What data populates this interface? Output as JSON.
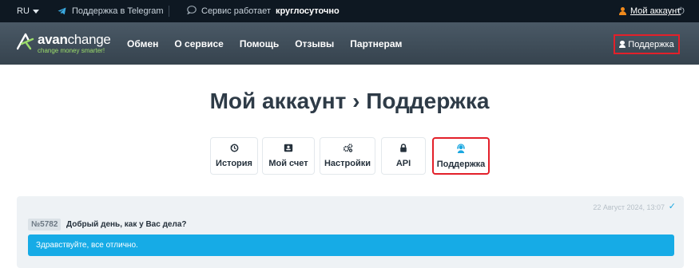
{
  "topbar": {
    "language": "RU",
    "telegram_label": "Поддержка в Telegram",
    "service_prefix": "Сервис работает",
    "service_emph": "круглосуточно",
    "account_label": "Мой аккаунт",
    "power_icon": "power-icon"
  },
  "header": {
    "logo_avan": "avan",
    "logo_change": "change",
    "logo_tagline": "change money smarter!",
    "nav": [
      "Обмен",
      "О сервисе",
      "Помощь",
      "Отзывы",
      "Партнерам"
    ],
    "support_button": "Поддержка"
  },
  "page": {
    "title": "Мой аккаунт › Поддержка"
  },
  "tabs": [
    {
      "label": "История",
      "icon": "history-icon"
    },
    {
      "label": "Мой счет",
      "icon": "id-card-icon"
    },
    {
      "label": "Настройки",
      "icon": "gears-icon"
    },
    {
      "label": "API",
      "icon": "lock-icon"
    },
    {
      "label": "Поддержка",
      "icon": "support-agent-icon"
    }
  ],
  "ticket": {
    "date": "22 Август 2024, 13:07",
    "number": "№5782",
    "message": "Добрый день, как у Вас дела?",
    "reply": "Здравствуйте, все отлично."
  },
  "colors": {
    "accent": "#16abe6",
    "highlight": "#e3202a",
    "topbar_bg": "#0e1822",
    "header_bg": "#3f4d59",
    "logo_green": "#9bdc6a",
    "account_orange": "#f08a1c"
  }
}
